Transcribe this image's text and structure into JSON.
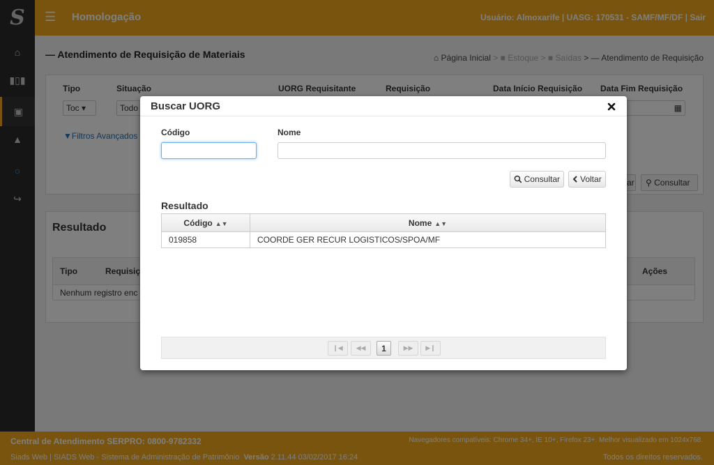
{
  "header": {
    "environment": "Homologação",
    "user_info": "Usuário: Almoxarife | UASG: 170531 - SAMF/MF/DF | Sair"
  },
  "page": {
    "title": "Atendimento de Requisição de Materiais",
    "breadcrumb": [
      "Página Inicial",
      "Estoque",
      "Saídas",
      "Atendimento de Requisição"
    ]
  },
  "filters": {
    "labels": {
      "tipo": "Tipo",
      "situacao": "Situação",
      "uorg": "UORG Requisitante",
      "requisicao": "Requisição",
      "data_inicio": "Data Início Requisição",
      "data_fim": "Data Fim Requisição"
    },
    "tipo_value": "Toc",
    "situacao_value": "Todo",
    "advanced": "Filtros Avançados",
    "limpar": "Limpar",
    "consultar": "Consultar"
  },
  "results_bg": {
    "title": "Resultado",
    "columns": [
      "Tipo",
      "Requisição",
      "Ações"
    ],
    "empty": "Nenhum registro enc"
  },
  "footer": {
    "support": "Central de Atendimento SERPRO: 0800-9782332",
    "browsers": "Navegadores compatíveis: Chrome 34+, IE 10+, Firefox 23+. Melhor visualizado em 1024x768.",
    "system": "Siads Web | SIADS Web - Sistema de Administração de Patrimônio",
    "version_label": "Versão",
    "version": "2.11.44 03/02/2017 16:24",
    "rights": "Todos os direitos reservados."
  },
  "modal": {
    "title": "Buscar UORG",
    "codigo_label": "Código",
    "nome_label": "Nome",
    "codigo_value": "",
    "nome_value": "",
    "consultar_label": "Consultar",
    "voltar_label": "Voltar",
    "result_title": "Resultado",
    "columns": [
      "Código",
      "Nome"
    ],
    "rows": [
      {
        "codigo": "019858",
        "nome": "COORDE GER RECUR LOGISTICOS/SPOA/MF"
      }
    ],
    "pagination": {
      "current_page": "1"
    }
  },
  "colors": {
    "accent": "#f0a91e",
    "sidebar": "#2a2a2a",
    "link": "#2a6fb0"
  }
}
